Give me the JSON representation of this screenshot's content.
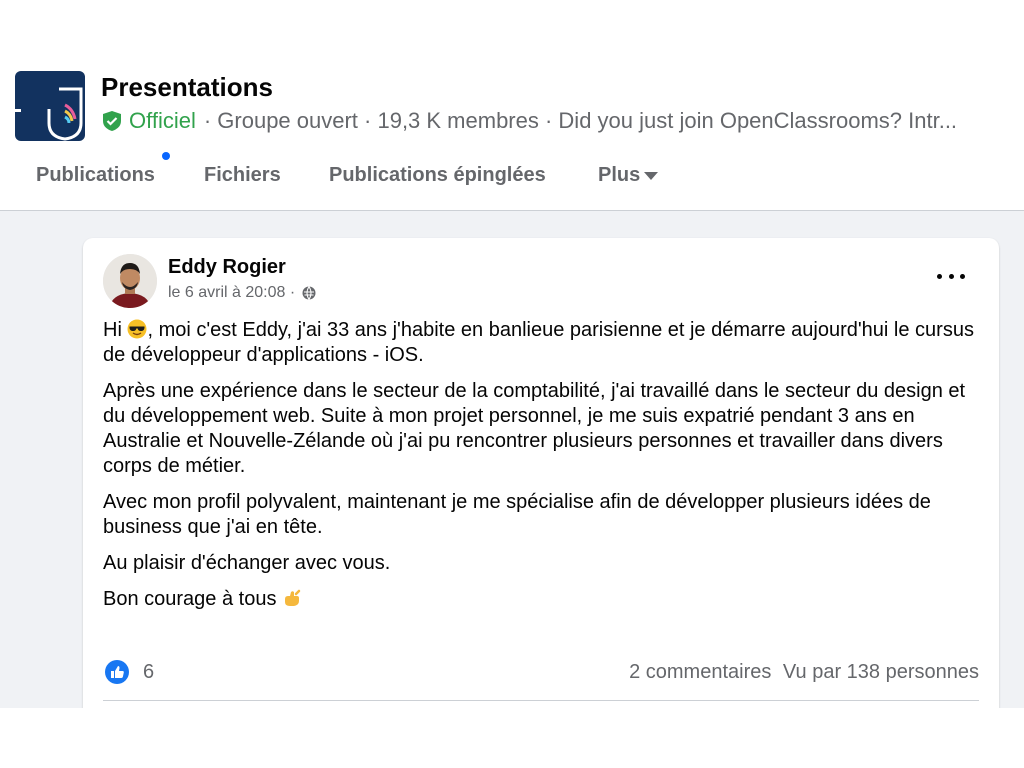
{
  "group": {
    "title": "Presentations",
    "official_label": "Officiel",
    "meta": "· Groupe ouvert · 19,3 K membres · Did you just join OpenClassrooms? Intr...",
    "colors": {
      "official": "#31a24c",
      "logo_bg": "#12325f"
    }
  },
  "tabs": [
    {
      "label": "Publications",
      "has_dot": true
    },
    {
      "label": "Fichiers"
    },
    {
      "label": "Publications épinglées"
    },
    {
      "label": "Plus"
    }
  ],
  "post": {
    "author": "Eddy Rogier",
    "timestamp": "le 6 avril à 20:08 ·",
    "paragraphs": {
      "p1_start": "Hi",
      "p1_rest": ", moi c'est Eddy, j'ai 33 ans j'habite en banlieue parisienne et je démarre aujourd'hui le cursus de développeur d'applications - iOS.",
      "p2": "Après une expérience dans le secteur de la comptabilité, j'ai travaillé dans le secteur du design et du développement web. Suite à mon projet personnel, je me suis expatrié pendant 3 ans en Australie et Nouvelle-Zélande où j'ai pu rencontrer plusieurs personnes et travailler dans divers corps de métier.",
      "p3": "Avec mon profil polyvalent, maintenant je me spécialise afin de développer plusieurs idées de business que j'ai en tête.",
      "p4": "Au plaisir d'échanger avec vous.",
      "p5": "Bon courage à tous"
    },
    "icons": {
      "emoji_1": "sunglasses-emoji",
      "emoji_2": "call-me-hand-emoji",
      "privacy": "globe-icon",
      "reaction": "like-icon"
    },
    "like_count": "6",
    "comments_label": "2 commentaires",
    "views_label": "Vu par 138 personnes"
  }
}
